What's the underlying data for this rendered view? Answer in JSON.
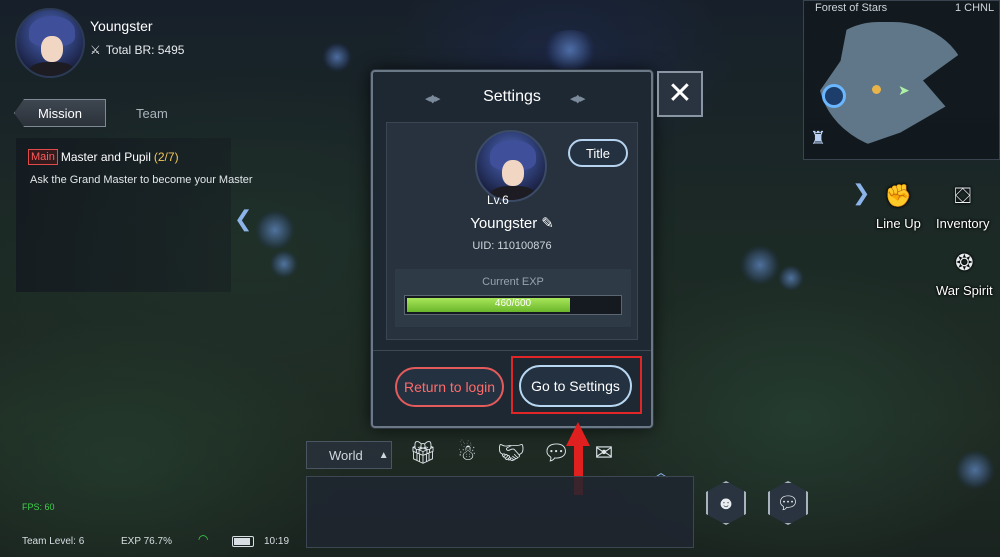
{
  "player": {
    "name": "Youngster",
    "total_br": "Total BR: 5495"
  },
  "mission_panel": {
    "tabs": [
      "Mission",
      "Team"
    ],
    "quest_type": "Main",
    "quest_name": "Master and Pupil",
    "quest_progress": "(2/7)",
    "quest_desc": "Ask the Grand Master to become your Master"
  },
  "settings_dialog": {
    "title": "Settings",
    "level": "Lv.6",
    "player_name": "Youngster",
    "uid": "UID:  110100876",
    "title_button": "Title",
    "exp_label": "Current EXP",
    "exp_text": "460/600",
    "exp_fraction": 0.767,
    "return_button": "Return to login",
    "settings_button": "Go to Settings",
    "close_icon": "close-icon"
  },
  "minimap": {
    "location": "Forest of Stars",
    "channel": "1 CHNL"
  },
  "side_menu": {
    "line_up": "Line Up",
    "inventory": "Inventory",
    "war_spirit": "War Spirit"
  },
  "chat": {
    "channel": "World",
    "icons": [
      "gift-icon",
      "npc-icon",
      "handshake-icon",
      "speech-bubble-icon",
      "mail-icon"
    ]
  },
  "status_bar": {
    "fps": "FPS: 60",
    "team_level": "Team Level: 6",
    "exp_percent": "EXP 76.7%",
    "time": "10:19"
  },
  "colors": {
    "accent_red": "#e02626",
    "exp_green": "#8bd345",
    "button_blue_border": "#b8d7f2",
    "return_red": "#e35b5b"
  }
}
